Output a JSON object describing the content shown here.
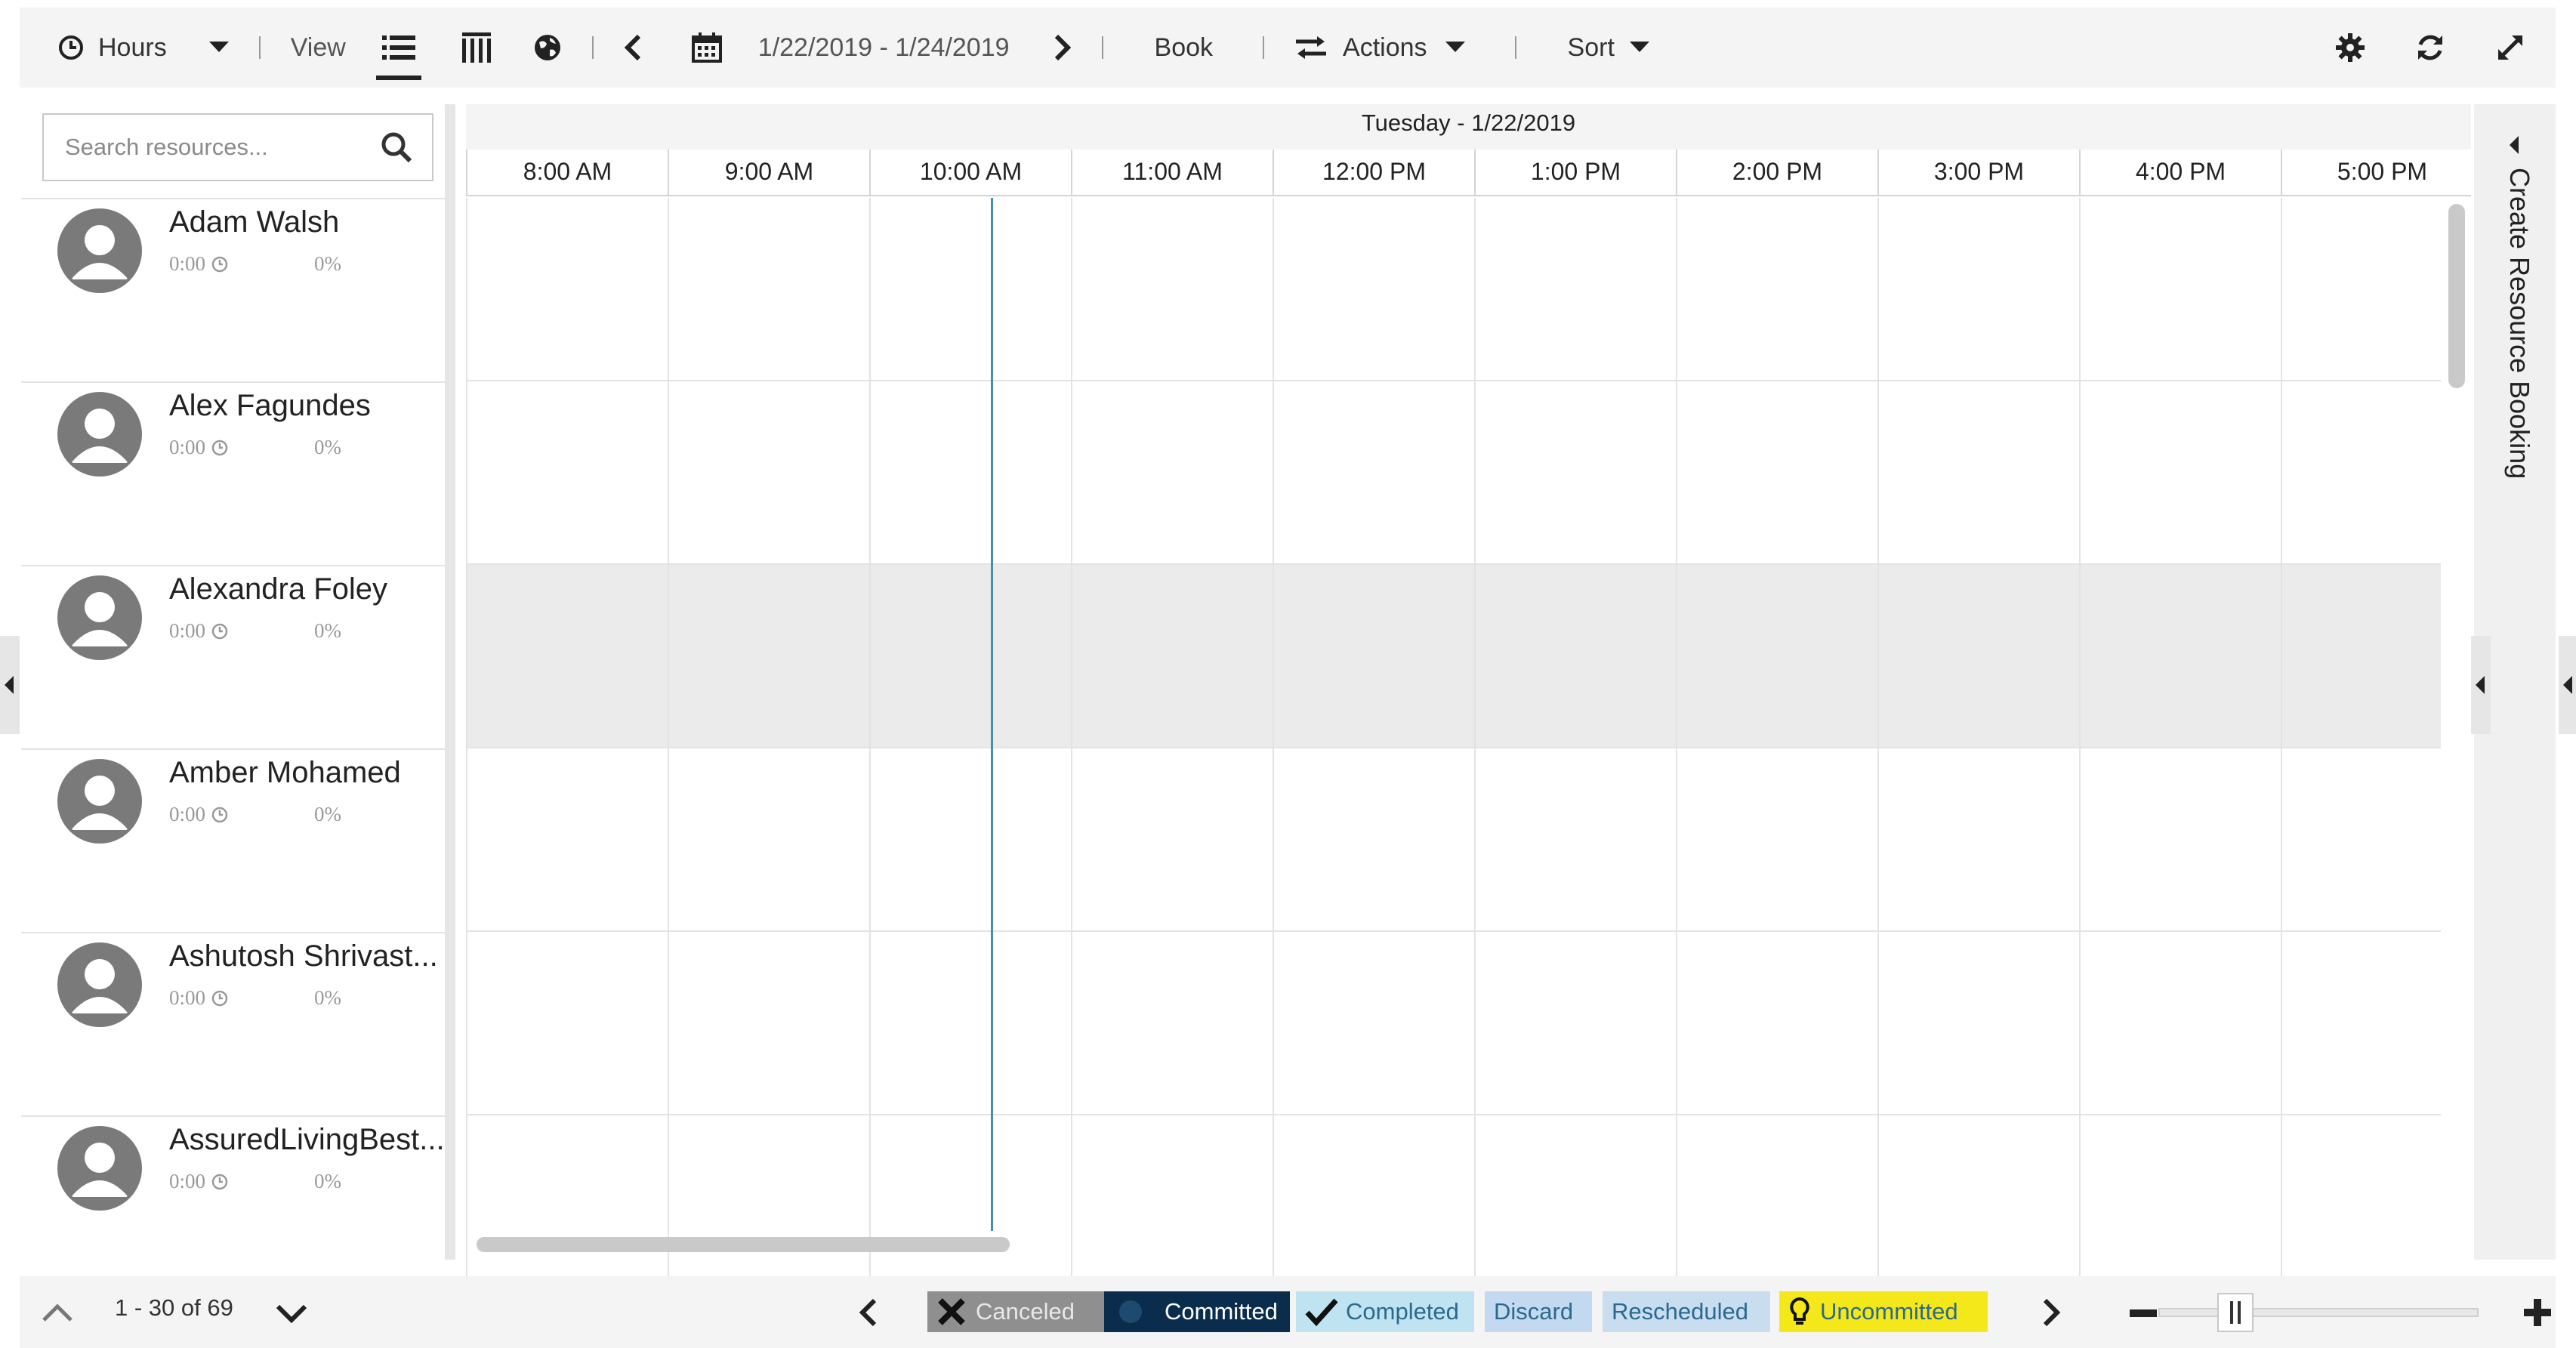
{
  "toolbar": {
    "hours_label": "Hours",
    "view_label": "View",
    "date_range": "1/22/2019 - 1/24/2019",
    "book_label": "Book",
    "actions_label": "Actions",
    "sort_label": "Sort"
  },
  "search": {
    "placeholder": "Search resources..."
  },
  "resources": [
    {
      "name": "Adam Walsh",
      "hours": "0:00",
      "percent": "0%"
    },
    {
      "name": "Alex Fagundes",
      "hours": "0:00",
      "percent": "0%"
    },
    {
      "name": "Alexandra Foley",
      "hours": "0:00",
      "percent": "0%"
    },
    {
      "name": "Amber Mohamed",
      "hours": "0:00",
      "percent": "0%"
    },
    {
      "name": "Ashutosh Shrivast...",
      "hours": "0:00",
      "percent": "0%"
    },
    {
      "name": "AssuredLivingBest...",
      "hours": "0:00",
      "percent": "0%"
    }
  ],
  "schedule": {
    "day_label": "Tuesday - 1/22/2019",
    "hours": [
      "8:00 AM",
      "9:00 AM",
      "10:00 AM",
      "11:00 AM",
      "12:00 PM",
      "1:00 PM",
      "2:00 PM",
      "3:00 PM",
      "4:00 PM",
      "5:00 PM"
    ]
  },
  "right_panel": {
    "create_booking_label": "Create Resource Booking"
  },
  "footer": {
    "pager_label": "1 - 30 of 69",
    "legend": {
      "canceled": "Canceled",
      "committed": "Committed",
      "completed": "Completed",
      "discard": "Discard",
      "rescheduled": "Rescheduled",
      "uncommitted": "Uncommitted"
    }
  },
  "colors": {
    "now_line": "#3f8fb8",
    "canceled_bg": "#8f8f8f",
    "committed_bg": "#0b2d4d",
    "completed_bg": "#bfe3f0",
    "discard_bg": "#c3d9ef",
    "rescheduled_bg": "#c8ddf0",
    "uncommitted_bg": "#f4e81a"
  },
  "icons": {
    "hours": "clock-icon",
    "view_list": "list-view-icon",
    "view_columns": "gantt-columns-icon",
    "map": "globe-icon",
    "calendar": "calendar-icon",
    "settings": "gear-icon",
    "refresh": "refresh-icon",
    "expand": "expand-icon"
  }
}
